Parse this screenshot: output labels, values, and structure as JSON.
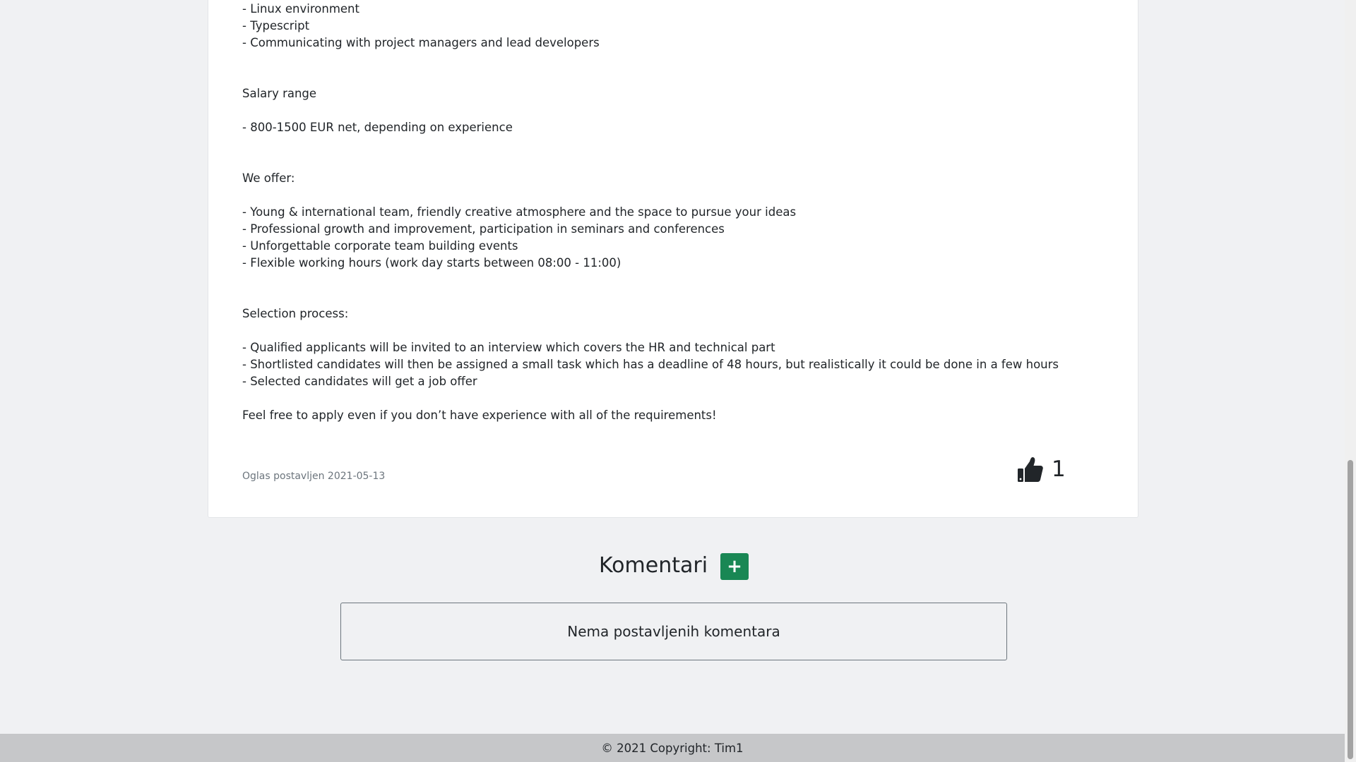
{
  "job": {
    "description": "- Linux environment\n- Typescript\n- Communicating with project managers and lead developers\n\n\nSalary range\n\n- 800-1500 EUR net, depending on experience\n\n\nWe offer:\n\n- Young & international team, friendly creative atmosphere and the space to pursue your ideas\n- Professional growth and improvement, participation in seminars and conferences\n- Unforgettable corporate team building events\n- Flexible working hours (work day starts between 08:00 - 11:00)\n\n\nSelection process:\n\n- Qualified applicants will be invited to an interview which covers the HR and technical part\n- Shortlisted candidates will then be assigned a small task which has a deadline of 48 hours, but realistically it could be done in a few hours\n- Selected candidates will get a job offer\n\nFeel free to apply even if you don’t have experience with all of the requirements!",
    "posted": "Oglas postavljen 2021-05-13",
    "likes": "1",
    "like_icon": "thumbs-up-icon"
  },
  "comments": {
    "title": "Komentari",
    "add_label": "+",
    "empty_text": "Nema postavljenih komentara"
  },
  "footer": {
    "copyright": "© 2021 Copyright: Tim1"
  },
  "colors": {
    "page_bg": "#f0f1f3",
    "add_button": "#198754",
    "footer_bg": "#c6c7c9"
  }
}
